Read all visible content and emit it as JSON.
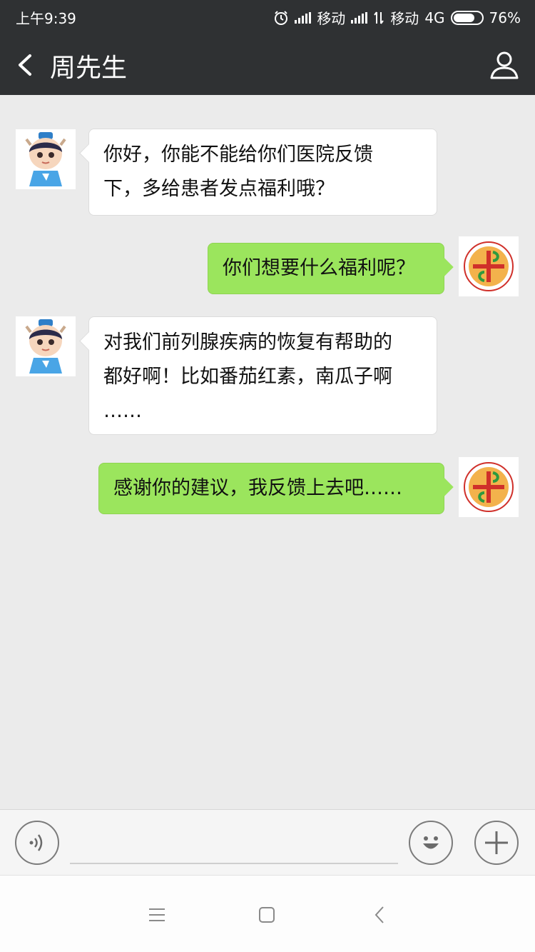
{
  "status_bar": {
    "time": "上午9:39",
    "carrier1": "移动",
    "carrier2": "移动",
    "network": "4G",
    "battery_percent": "76%",
    "battery_level": 0.76
  },
  "header": {
    "title": "周先生",
    "back_icon": "chevron-left-icon",
    "profile_icon": "person-icon"
  },
  "messages": [
    {
      "side": "incoming",
      "text_lines": [
        "你好，你能不能给你们医院反馈",
        "下，多给患者发点福利哦？"
      ]
    },
    {
      "side": "outgoing",
      "text_lines": [
        "你们想要什么福利呢？"
      ]
    },
    {
      "side": "incoming",
      "text_lines": [
        "对我们前列腺疾病的恢复有帮助的",
        "都好啊！比如番茄红素，南瓜子啊",
        "……"
      ]
    },
    {
      "side": "outgoing",
      "text_lines": [
        "感谢你的建议，我反馈上去吧……"
      ]
    }
  ],
  "input_bar": {
    "voice_icon": "voice-icon",
    "emoji_icon": "smiley-icon",
    "plus_icon": "plus-icon",
    "input_value": ""
  },
  "colors": {
    "header_bg": "#2f3133",
    "chat_bg": "#ebebeb",
    "outgoing_bubble": "#9be55d",
    "incoming_bubble": "#ffffff"
  }
}
